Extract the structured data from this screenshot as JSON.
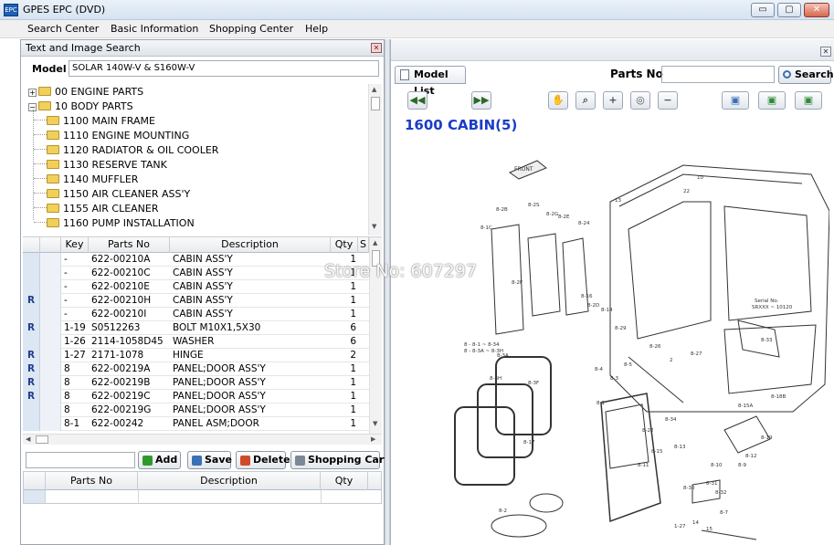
{
  "window": {
    "title": "GPES EPC (DVD)",
    "controls": {
      "minimize": "▭",
      "maximize": "▢",
      "close": "✕"
    }
  },
  "menu": [
    "Search Center",
    "Basic Information",
    "Shopping Center",
    "Help"
  ],
  "left_panel": {
    "title": "Text and Image Search",
    "model_label": "Model",
    "model_value": "SOLAR 140W-V & S160W-V",
    "tree": [
      {
        "label": "00 ENGINE PARTS",
        "level": 0,
        "expander": "+"
      },
      {
        "label": "10 BODY PARTS",
        "level": 0,
        "expander": "−"
      },
      {
        "label": "1100 MAIN FRAME",
        "level": 1
      },
      {
        "label": "1110 ENGINE MOUNTING",
        "level": 1
      },
      {
        "label": "1120 RADIATOR & OIL COOLER",
        "level": 1
      },
      {
        "label": "1130 RESERVE TANK",
        "level": 1
      },
      {
        "label": "1140 MUFFLER",
        "level": 1
      },
      {
        "label": "1150 AIR CLEANER ASS'Y",
        "level": 1
      },
      {
        "label": "1155 AIR CLEANER",
        "level": 1
      },
      {
        "label": "1160 PUMP INSTALLATION",
        "level": 1
      }
    ],
    "grid": {
      "columns": [
        "Key",
        "Parts No",
        "Description",
        "Qty",
        "S"
      ],
      "rows": [
        {
          "mark": "",
          "key": "-",
          "parts_no": "622-00210A",
          "desc": "CABIN ASS'Y",
          "qty": "1"
        },
        {
          "mark": "",
          "key": "-",
          "parts_no": "622-00210C",
          "desc": "CABIN ASS'Y",
          "qty": "1"
        },
        {
          "mark": "",
          "key": "-",
          "parts_no": "622-00210E",
          "desc": "CABIN ASS'Y",
          "qty": "1"
        },
        {
          "mark": "R",
          "key": "-",
          "parts_no": "622-00210H",
          "desc": "CABIN ASS'Y",
          "qty": "1"
        },
        {
          "mark": "",
          "key": "-",
          "parts_no": "622-00210I",
          "desc": "CABIN ASS'Y",
          "qty": "1"
        },
        {
          "mark": "R",
          "key": "1-19",
          "parts_no": "S0512263",
          "desc": "BOLT M10X1,5X30",
          "qty": "6"
        },
        {
          "mark": "",
          "key": "1-26",
          "parts_no": "2114-1058D45",
          "desc": "WASHER",
          "qty": "6"
        },
        {
          "mark": "R",
          "key": "1-27",
          "parts_no": "2171-1078",
          "desc": "HINGE",
          "qty": "2"
        },
        {
          "mark": "R",
          "key": "8",
          "parts_no": "622-00219A",
          "desc": "PANEL;DOOR ASS'Y",
          "qty": "1"
        },
        {
          "mark": "R",
          "key": "8",
          "parts_no": "622-00219B",
          "desc": "PANEL;DOOR ASS'Y",
          "qty": "1"
        },
        {
          "mark": "R",
          "key": "8",
          "parts_no": "622-00219C",
          "desc": "PANEL;DOOR ASS'Y",
          "qty": "1"
        },
        {
          "mark": "",
          "key": "8",
          "parts_no": "622-00219G",
          "desc": "PANEL;DOOR ASS'Y",
          "qty": "1"
        },
        {
          "mark": "",
          "key": "8-1",
          "parts_no": "622-00242",
          "desc": "PANEL ASM;DOOR",
          "qty": "1"
        }
      ]
    },
    "buttons": {
      "add": "Add",
      "save": "Save",
      "delete": "Delete",
      "cart": "Shopping Cart"
    },
    "cart_columns": [
      "Parts No",
      "Description",
      "Qty"
    ]
  },
  "right_panel": {
    "tab_label": "Model List",
    "parts_no_label": "Parts No",
    "search_label": "Search",
    "diagram_title": "1600 CABIN(5)",
    "watermark": "Store No: 607297",
    "diagram_texts": {
      "front": "FRONT",
      "serial": "Serial No.",
      "serial_range": "SRXXX ~ 10120",
      "range_a": "8 - 8-1 ~ 8-34",
      "range_b": "8 - 8-3A ~ 8-3H"
    },
    "diagram_labels": [
      "8-2B",
      "8-2S",
      "8-2G",
      "8-2E",
      "8-24",
      "8-1C",
      "8-2F",
      "8-16",
      "8-2D",
      "8-14",
      "8-3A",
      "8-3H",
      "8-3",
      "8-1",
      "8-17",
      "8-22",
      "8-15",
      "8-13",
      "8-34",
      "8-7",
      "8-2",
      "8-11",
      "8-12",
      "8-9",
      "8-19",
      "8-10",
      "8-26",
      "8-27",
      "8-33",
      "1-27",
      "14",
      "15",
      "8-3F",
      "8-15A",
      "8-18B",
      "8-29",
      "8-4",
      "8-5",
      "2",
      "13",
      "22",
      "10",
      "8-30",
      "8-31",
      "8-32"
    ]
  }
}
